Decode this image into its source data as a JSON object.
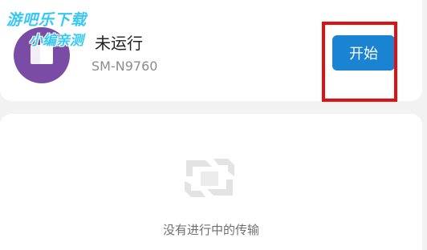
{
  "device": {
    "status": "未运行",
    "name": "SM-N9760",
    "start_button": "开始"
  },
  "empty_state": {
    "message": "没有进行中的传输"
  },
  "watermark": {
    "line1": "游吧乐下载",
    "line2": "小编亲测"
  },
  "colors": {
    "accent": "#1a83d2",
    "avatar": "#7b4ca6",
    "highlight": "#e01010",
    "watermark": "#36c8f5"
  }
}
